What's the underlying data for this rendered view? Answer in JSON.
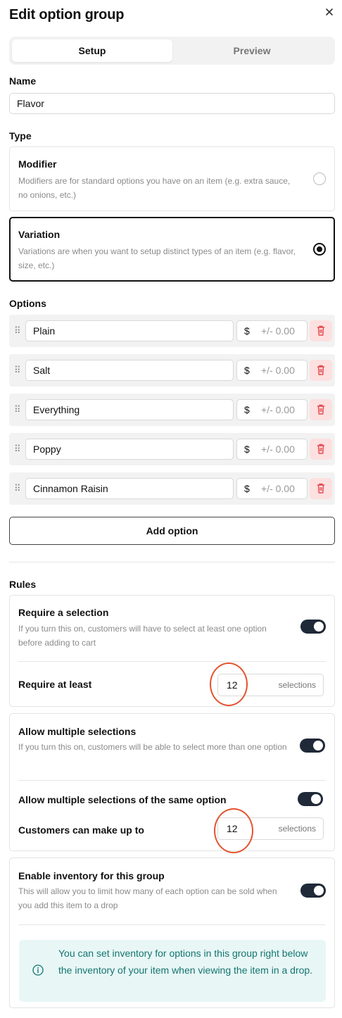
{
  "header": {
    "title": "Edit option group",
    "close_icon": "close-icon"
  },
  "tabs": [
    {
      "label": "Setup",
      "active": true
    },
    {
      "label": "Preview",
      "active": false
    }
  ],
  "name": {
    "label": "Name",
    "value": "Flavor"
  },
  "type": {
    "label": "Type",
    "options": [
      {
        "title": "Modifier",
        "description": "Modifiers are for standard options you have on an item (e.g. extra sauce, no onions, etc.)",
        "selected": false
      },
      {
        "title": "Variation",
        "description": "Variations are when you want to setup distinct types of an item (e.g. flavor, size, etc.)",
        "selected": true
      }
    ]
  },
  "options": {
    "label": "Options",
    "items": [
      {
        "name": "Plain",
        "currency": "$",
        "price_placeholder": "+/- 0.00"
      },
      {
        "name": "Salt",
        "currency": "$",
        "price_placeholder": "+/- 0.00"
      },
      {
        "name": "Everything",
        "currency": "$",
        "price_placeholder": "+/- 0.00"
      },
      {
        "name": "Poppy",
        "currency": "$",
        "price_placeholder": "+/- 0.00"
      },
      {
        "name": "Cinnamon Raisin",
        "currency": "$",
        "price_placeholder": "+/- 0.00"
      }
    ],
    "add_label": "Add option"
  },
  "rules": {
    "label": "Rules",
    "require_selection": {
      "title": "Require a selection",
      "description": "If you turn this on, customers will have to select at least one option before adding to cart",
      "enabled": true,
      "min_label": "Require at least",
      "min_value": "12",
      "unit": "selections"
    },
    "multiple_selections": {
      "title": "Allow multiple selections",
      "description": "If you turn this on, customers will be able to select more than one option",
      "enabled": true,
      "same_option_label": "Allow multiple selections of the same option",
      "same_option_enabled": true,
      "max_label": "Customers can make up to",
      "max_value": "12",
      "unit": "selections"
    },
    "inventory": {
      "title": "Enable inventory for this group",
      "description": "This will allow you to limit how many of each option can be sold when you add this item to a drop",
      "enabled": true,
      "info": "You can set inventory for options in this group right below the inventory of your item when viewing the item in a drop."
    }
  },
  "colors": {
    "accent": "#111111",
    "annotation": "#e4532f",
    "info_bg": "#e8f6f6",
    "info_text": "#13756f",
    "delete_bg": "#fde0e0",
    "delete_icon": "#e5484d"
  }
}
